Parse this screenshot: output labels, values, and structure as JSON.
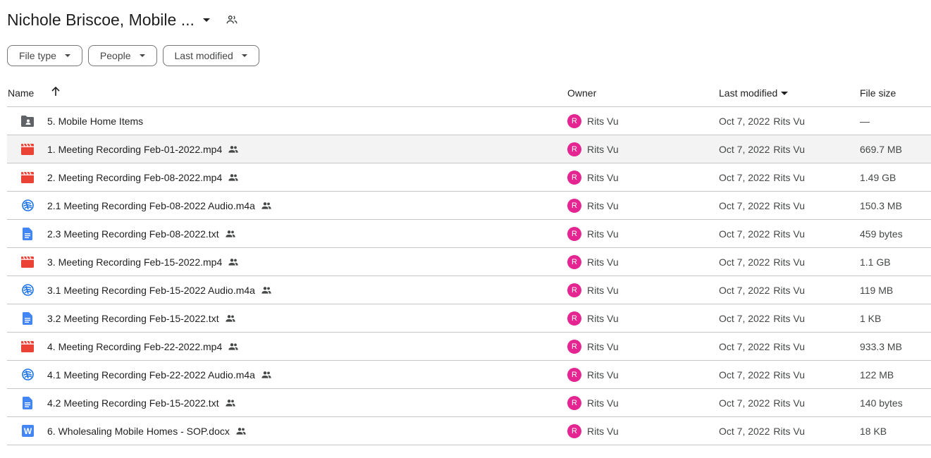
{
  "title": "Nichole Briscoe, Mobile ...",
  "filters": [
    {
      "label": "File type"
    },
    {
      "label": "People"
    },
    {
      "label": "Last modified"
    }
  ],
  "columns": {
    "name": "Name",
    "owner": "Owner",
    "modified": "Last modified",
    "size": "File size"
  },
  "colors": {
    "avatar": "#e52592",
    "video_icon": "#ea4335",
    "doc_icon": "#4285f4",
    "audio_icon": "#1a73e8",
    "folder_icon": "#5f6368"
  },
  "files": [
    {
      "icon": "shared-folder-icon",
      "name": "5. Mobile Home Items",
      "shared": false,
      "owner_initial": "R",
      "owner": "Rits Vu",
      "modified": "Oct 7, 2022",
      "modified_by": "Rits Vu",
      "size": "—"
    },
    {
      "icon": "video-file-icon",
      "name": "1. Meeting Recording Feb-01-2022.mp4",
      "shared": true,
      "owner_initial": "R",
      "owner": "Rits Vu",
      "modified": "Oct 7, 2022",
      "modified_by": "Rits Vu",
      "size": "669.7 MB"
    },
    {
      "icon": "video-file-icon",
      "name": "2. Meeting Recording Feb-08-2022.mp4",
      "shared": true,
      "owner_initial": "R",
      "owner": "Rits Vu",
      "modified": "Oct 7, 2022",
      "modified_by": "Rits Vu",
      "size": "1.49 GB"
    },
    {
      "icon": "audio-file-icon",
      "name": "2.1 Meeting Recording Feb-08-2022 Audio.m4a",
      "shared": true,
      "owner_initial": "R",
      "owner": "Rits Vu",
      "modified": "Oct 7, 2022",
      "modified_by": "Rits Vu",
      "size": "150.3 MB"
    },
    {
      "icon": "text-file-icon",
      "name": "2.3 Meeting Recording Feb-08-2022.txt",
      "shared": true,
      "owner_initial": "R",
      "owner": "Rits Vu",
      "modified": "Oct 7, 2022",
      "modified_by": "Rits Vu",
      "size": "459 bytes"
    },
    {
      "icon": "video-file-icon",
      "name": "3. Meeting Recording Feb-15-2022.mp4",
      "shared": true,
      "owner_initial": "R",
      "owner": "Rits Vu",
      "modified": "Oct 7, 2022",
      "modified_by": "Rits Vu",
      "size": "1.1 GB"
    },
    {
      "icon": "audio-file-icon",
      "name": "3.1 Meeting Recording Feb-15-2022 Audio.m4a",
      "shared": true,
      "owner_initial": "R",
      "owner": "Rits Vu",
      "modified": "Oct 7, 2022",
      "modified_by": "Rits Vu",
      "size": "119 MB"
    },
    {
      "icon": "text-file-icon",
      "name": "3.2 Meeting Recording Feb-15-2022.txt",
      "shared": true,
      "owner_initial": "R",
      "owner": "Rits Vu",
      "modified": "Oct 7, 2022",
      "modified_by": "Rits Vu",
      "size": "1 KB"
    },
    {
      "icon": "video-file-icon",
      "name": "4. Meeting Recording Feb-22-2022.mp4",
      "shared": true,
      "owner_initial": "R",
      "owner": "Rits Vu",
      "modified": "Oct 7, 2022",
      "modified_by": "Rits Vu",
      "size": "933.3 MB"
    },
    {
      "icon": "audio-file-icon",
      "name": "4.1 Meeting Recording Feb-22-2022 Audio.m4a",
      "shared": true,
      "owner_initial": "R",
      "owner": "Rits Vu",
      "modified": "Oct 7, 2022",
      "modified_by": "Rits Vu",
      "size": "122 MB"
    },
    {
      "icon": "text-file-icon",
      "name": "4.2 Meeting Recording Feb-15-2022.txt",
      "shared": true,
      "owner_initial": "R",
      "owner": "Rits Vu",
      "modified": "Oct 7, 2022",
      "modified_by": "Rits Vu",
      "size": "140 bytes"
    },
    {
      "icon": "word-file-icon",
      "name": "6. Wholesaling Mobile Homes - SOP.docx",
      "shared": true,
      "owner_initial": "R",
      "owner": "Rits Vu",
      "modified": "Oct 7, 2022",
      "modified_by": "Rits Vu",
      "size": "18 KB"
    }
  ]
}
